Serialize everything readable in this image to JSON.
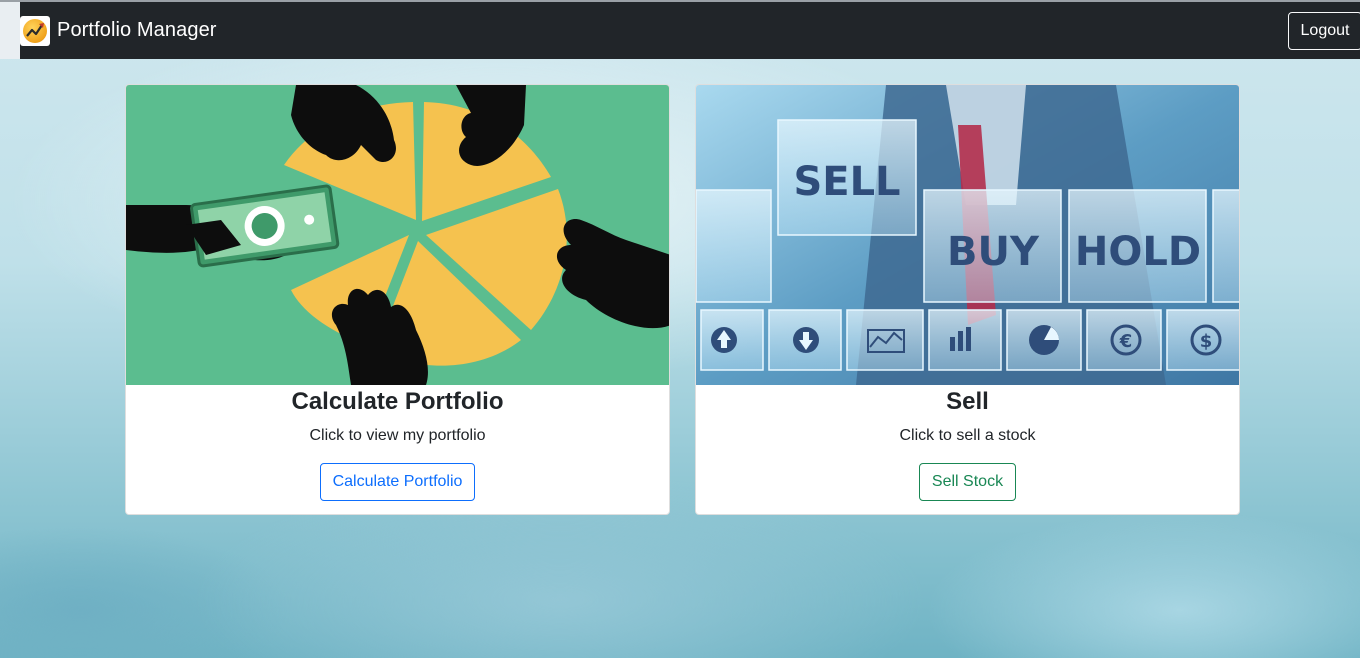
{
  "navbar": {
    "brand_title": "Portfolio Manager",
    "logo_icon": "chart-coin-icon",
    "logout_label": "Logout"
  },
  "cards": [
    {
      "image_icon": "pie-chart-hands-illustration",
      "title": "Calculate Portfolio",
      "text": "Click to view my portfolio",
      "button_label": "Calculate Portfolio",
      "button_color": "#0d6efd"
    },
    {
      "image_icon": "sell-buy-hold-photo",
      "image_words": [
        "SELL",
        "BUY",
        "HOLD"
      ],
      "title": "Sell",
      "text": "Click to sell a stock",
      "button_label": "Sell Stock",
      "button_color": "#198754"
    }
  ],
  "colors": {
    "navbar_bg": "#212529",
    "illustration_bg": "#5bbd8f",
    "pie_yellow": "#f5c24f"
  }
}
